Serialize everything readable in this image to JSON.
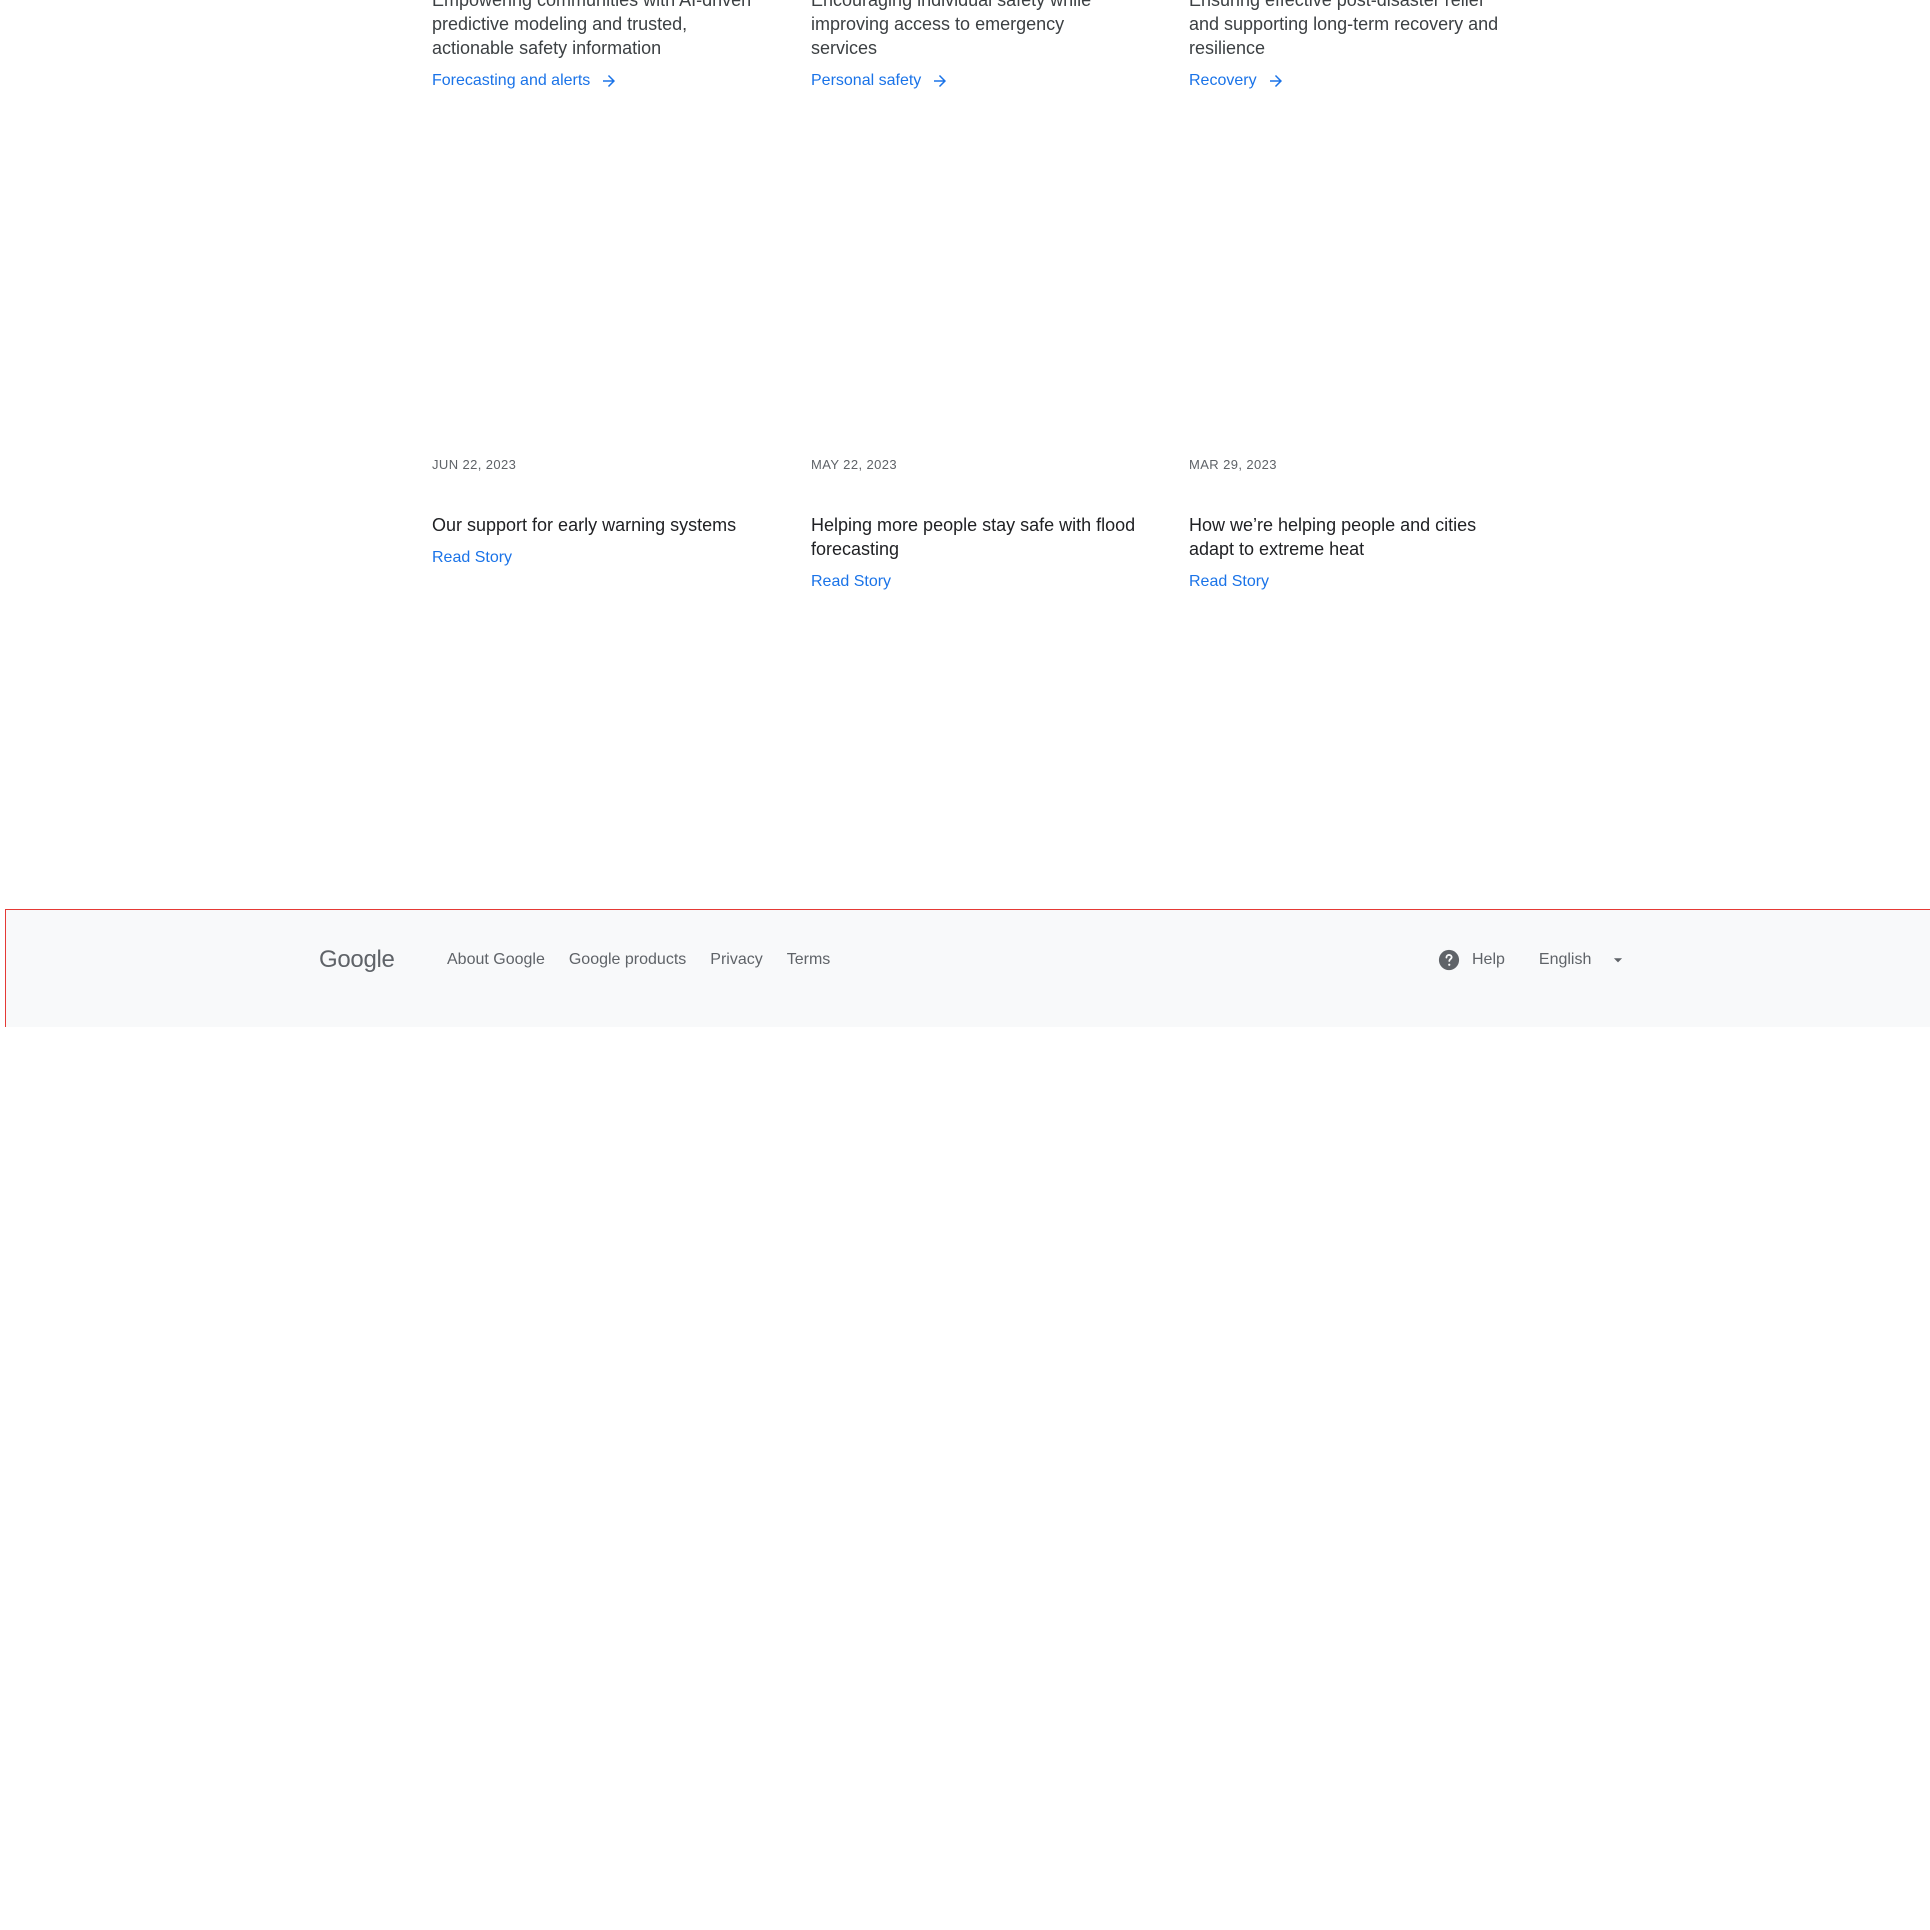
{
  "features": [
    {
      "description": "Empowering communities with AI-driven predictive modeling and trusted, actionable safety information",
      "link_label": "Forecasting and alerts",
      "icon": "arrow-right-icon"
    },
    {
      "description": "Encouraging individual safety while improving access to emergency services",
      "link_label": "Personal safety",
      "icon": "arrow-right-icon"
    },
    {
      "description": "Ensuring effective post-disaster relief and supporting long-term recovery and resilience",
      "link_label": "Recovery",
      "icon": "arrow-right-icon"
    }
  ],
  "stories": [
    {
      "date": "JUN 22, 2023",
      "title": "Our support for early warning systems",
      "cta": "Read Story"
    },
    {
      "date": "MAY 22, 2023",
      "title": "Helping more people stay safe with flood forecasting",
      "cta": "Read Story"
    },
    {
      "date": "MAR 29, 2023",
      "title": "How we’re helping people and cities adapt to extreme heat",
      "cta": "Read Story"
    }
  ],
  "footer": {
    "logo": "Google",
    "links": [
      "About Google",
      "Google products",
      "Privacy",
      "Terms"
    ],
    "help_label": "Help",
    "help_icon": "help-circle-icon",
    "language": "English",
    "language_icon": "caret-down-icon"
  },
  "colors": {
    "link": "#1a73e8",
    "footer_bg": "#f8f9fa",
    "muted_text": "#5f6368"
  }
}
